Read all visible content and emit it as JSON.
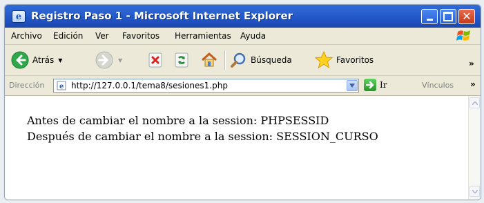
{
  "window": {
    "title": "Registro Paso 1 - Microsoft Internet Explorer"
  },
  "menu": {
    "items": [
      "Archivo",
      "Edición",
      "Ver",
      "Favoritos",
      "Herramientas",
      "Ayuda"
    ]
  },
  "toolbar": {
    "back_label": "Atrás",
    "search_label": "Búsqueda",
    "favorites_label": "Favoritos",
    "overflow": "»"
  },
  "address": {
    "label": "Dirección",
    "url": "http://127.0.0.1/tema8/sesiones1.php",
    "go_label": "Ir",
    "links_label": "Vínculos",
    "overflow": "»"
  },
  "page": {
    "lines": [
      "Antes de cambiar el nombre a la session: PHPSESSID",
      "Después de cambiar el nombre a la session: SESSION_CURSO"
    ]
  },
  "colors": {
    "titlebar": "#2b63d0",
    "close_button": "#c6391b",
    "chrome": "#ece9d8"
  },
  "icons": [
    "ie-page-icon",
    "minimize-icon",
    "maximize-icon",
    "close-icon",
    "windows-logo-icon",
    "back-arrow-icon",
    "forward-arrow-icon",
    "stop-icon",
    "refresh-icon",
    "home-icon",
    "search-icon",
    "favorites-star-icon",
    "dropdown-arrow-icon",
    "go-arrow-icon",
    "scroll-up-icon",
    "scroll-down-icon"
  ]
}
